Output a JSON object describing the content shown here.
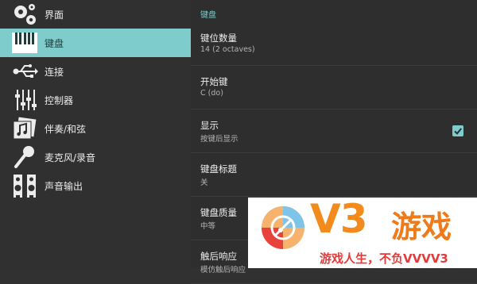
{
  "sidebar": {
    "items": [
      {
        "label": "界面",
        "icon": "gears-icon"
      },
      {
        "label": "键盘",
        "icon": "piano-keys-icon"
      },
      {
        "label": "连接",
        "icon": "usb-icon"
      },
      {
        "label": "控制器",
        "icon": "sliders-icon"
      },
      {
        "label": "伴奏/和弦",
        "icon": "music-note-icon"
      },
      {
        "label": "麦克风/录音",
        "icon": "microphone-icon"
      },
      {
        "label": "声音输出",
        "icon": "speakers-icon"
      }
    ]
  },
  "main": {
    "section_title": "键盘",
    "settings": [
      {
        "title": "键位数量",
        "subtitle": "14 (2 octaves)"
      },
      {
        "title": "开始键",
        "subtitle": "C (do)"
      },
      {
        "title": "显示",
        "subtitle": "按键后显示",
        "checked": true
      },
      {
        "title": "键盘标题",
        "subtitle": "关"
      },
      {
        "title": "键盘质量",
        "subtitle": "中等"
      },
      {
        "title": "触后响应",
        "subtitle": "模仿触后响应"
      }
    ]
  },
  "ad": {
    "brand": "V3",
    "brand_cn": "游戏",
    "slogan": "游戏人生，不负VVVV3"
  },
  "colors": {
    "accent": "#7ecccc",
    "background": "#2e2e2e",
    "ad_orange": "#f28a1c",
    "ad_red": "#e43a3a"
  }
}
